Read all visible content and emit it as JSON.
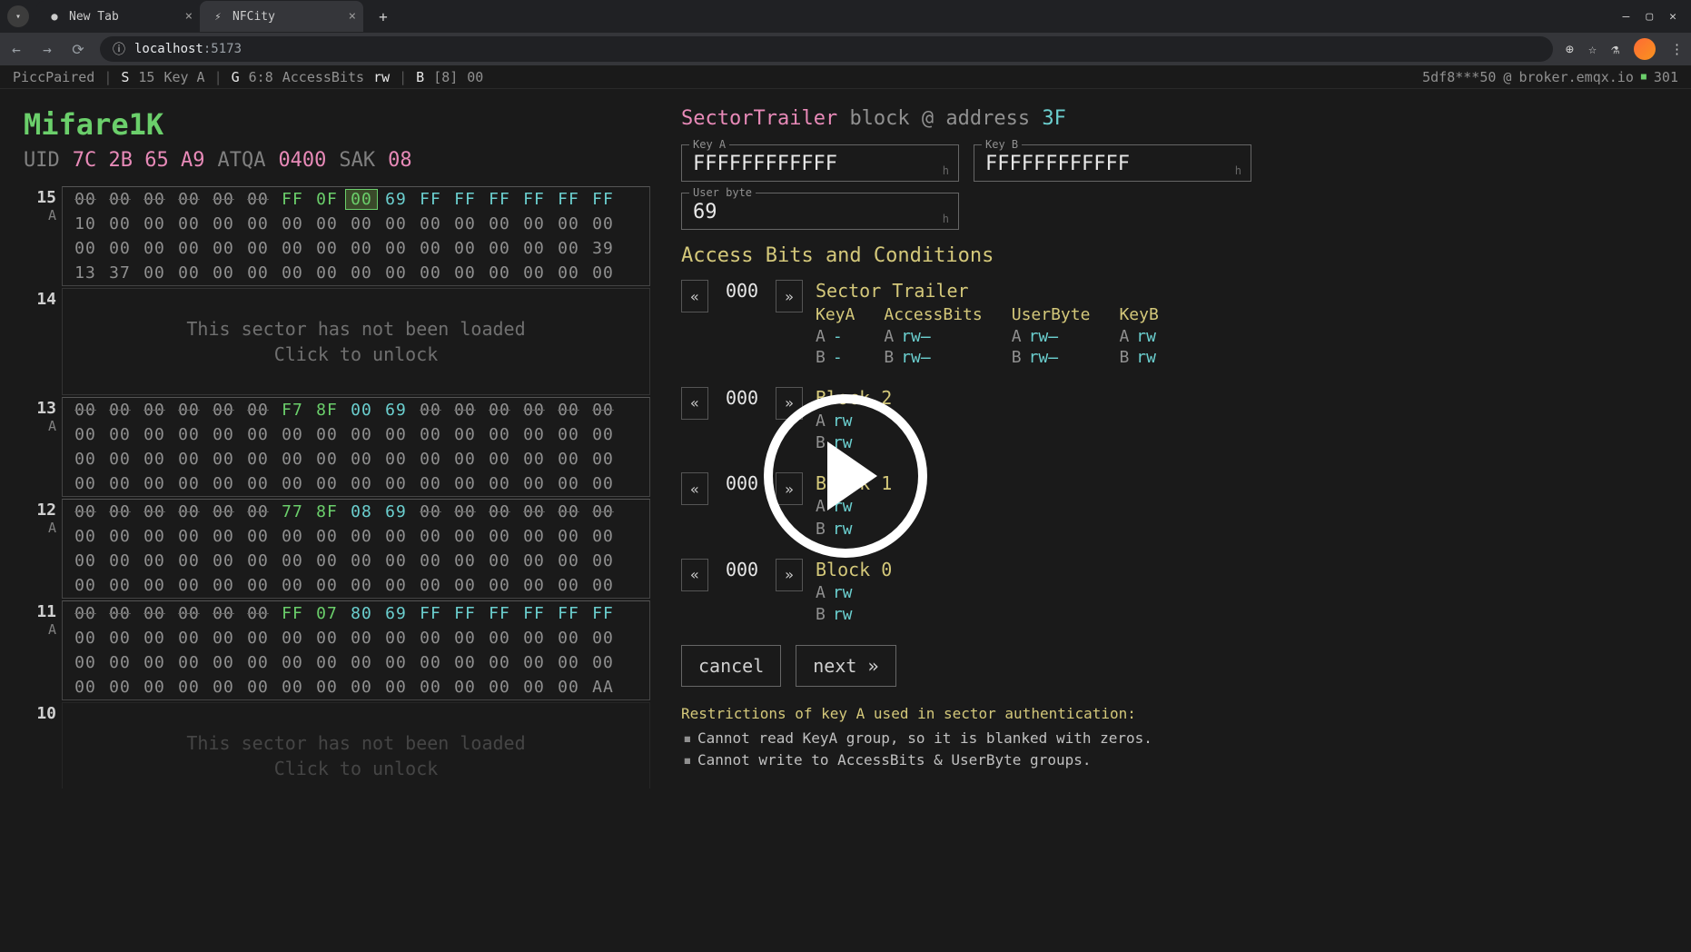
{
  "browser": {
    "tabs": [
      {
        "title": "New Tab",
        "active": false,
        "icon": "●"
      },
      {
        "title": "NFCity",
        "active": true,
        "icon": "⚡"
      }
    ],
    "url_host": "localhost",
    "url_port": ":5173",
    "win_min": "—",
    "win_max": "▢",
    "win_close": "✕"
  },
  "status": {
    "picc": "PiccPaired",
    "s_lbl": "S",
    "s_val": "15",
    "s_key": "Key A",
    "g_lbl": "G",
    "g_val": "6:8",
    "g_name": "AccessBits",
    "g_perm": "rw",
    "b_lbl": "B",
    "b_idx": "[8]",
    "b_val": "00",
    "conn_id": "5df8***50",
    "conn_at": "@",
    "conn_host": "broker.emqx.io",
    "conn_count": "301"
  },
  "card": {
    "title": "Mifare1K",
    "uid_lbl": "UID",
    "uid": "7C 2B 65 A9",
    "atqa_lbl": "ATQA",
    "atqa": "0400",
    "sak_lbl": "SAK",
    "sak": "08"
  },
  "sectors": [
    {
      "idx": "15",
      "key": "A",
      "loaded": true,
      "rows": [
        {
          "cells": [
            "00",
            "00",
            "00",
            "00",
            "00",
            "00",
            "FF",
            "0F",
            "00",
            "69",
            "FF",
            "FF",
            "FF",
            "FF",
            "FF",
            "FF"
          ],
          "style": [
            "s",
            "s",
            "s",
            "s",
            "s",
            "s",
            "g",
            "g",
            "h",
            "c",
            "c",
            "c",
            "c",
            "c",
            "c",
            "c"
          ]
        },
        {
          "cells": [
            "10",
            "00",
            "00",
            "00",
            "00",
            "00",
            "00",
            "00",
            "00",
            "00",
            "00",
            "00",
            "00",
            "00",
            "00",
            "00"
          ],
          "style": []
        },
        {
          "cells": [
            "00",
            "00",
            "00",
            "00",
            "00",
            "00",
            "00",
            "00",
            "00",
            "00",
            "00",
            "00",
            "00",
            "00",
            "00",
            "39"
          ],
          "style": []
        },
        {
          "cells": [
            "13",
            "37",
            "00",
            "00",
            "00",
            "00",
            "00",
            "00",
            "00",
            "00",
            "00",
            "00",
            "00",
            "00",
            "00",
            "00"
          ],
          "style": []
        }
      ]
    },
    {
      "idx": "14",
      "loaded": false
    },
    {
      "idx": "13",
      "key": "A",
      "loaded": true,
      "rows": [
        {
          "cells": [
            "00",
            "00",
            "00",
            "00",
            "00",
            "00",
            "F7",
            "8F",
            "00",
            "69",
            "00",
            "00",
            "00",
            "00",
            "00",
            "00"
          ],
          "style": [
            "s",
            "s",
            "s",
            "s",
            "s",
            "s",
            "g",
            "g",
            "c",
            "c",
            "s",
            "s",
            "s",
            "s",
            "s",
            "s"
          ]
        },
        {
          "cells": [
            "00",
            "00",
            "00",
            "00",
            "00",
            "00",
            "00",
            "00",
            "00",
            "00",
            "00",
            "00",
            "00",
            "00",
            "00",
            "00"
          ],
          "style": []
        },
        {
          "cells": [
            "00",
            "00",
            "00",
            "00",
            "00",
            "00",
            "00",
            "00",
            "00",
            "00",
            "00",
            "00",
            "00",
            "00",
            "00",
            "00"
          ],
          "style": []
        },
        {
          "cells": [
            "00",
            "00",
            "00",
            "00",
            "00",
            "00",
            "00",
            "00",
            "00",
            "00",
            "00",
            "00",
            "00",
            "00",
            "00",
            "00"
          ],
          "style": []
        }
      ]
    },
    {
      "idx": "12",
      "key": "A",
      "loaded": true,
      "rows": [
        {
          "cells": [
            "00",
            "00",
            "00",
            "00",
            "00",
            "00",
            "77",
            "8F",
            "08",
            "69",
            "00",
            "00",
            "00",
            "00",
            "00",
            "00"
          ],
          "style": [
            "s",
            "s",
            "s",
            "s",
            "s",
            "s",
            "g",
            "g",
            "c",
            "c",
            "s",
            "s",
            "s",
            "s",
            "s",
            "s"
          ]
        },
        {
          "cells": [
            "00",
            "00",
            "00",
            "00",
            "00",
            "00",
            "00",
            "00",
            "00",
            "00",
            "00",
            "00",
            "00",
            "00",
            "00",
            "00"
          ],
          "style": []
        },
        {
          "cells": [
            "00",
            "00",
            "00",
            "00",
            "00",
            "00",
            "00",
            "00",
            "00",
            "00",
            "00",
            "00",
            "00",
            "00",
            "00",
            "00"
          ],
          "style": []
        },
        {
          "cells": [
            "00",
            "00",
            "00",
            "00",
            "00",
            "00",
            "00",
            "00",
            "00",
            "00",
            "00",
            "00",
            "00",
            "00",
            "00",
            "00"
          ],
          "style": []
        }
      ]
    },
    {
      "idx": "11",
      "key": "A",
      "loaded": true,
      "rows": [
        {
          "cells": [
            "00",
            "00",
            "00",
            "00",
            "00",
            "00",
            "FF",
            "07",
            "80",
            "69",
            "FF",
            "FF",
            "FF",
            "FF",
            "FF",
            "FF"
          ],
          "style": [
            "s",
            "s",
            "s",
            "s",
            "s",
            "s",
            "g",
            "g",
            "c",
            "c",
            "c",
            "c",
            "c",
            "c",
            "c",
            "c"
          ]
        },
        {
          "cells": [
            "00",
            "00",
            "00",
            "00",
            "00",
            "00",
            "00",
            "00",
            "00",
            "00",
            "00",
            "00",
            "00",
            "00",
            "00",
            "00"
          ],
          "style": []
        },
        {
          "cells": [
            "00",
            "00",
            "00",
            "00",
            "00",
            "00",
            "00",
            "00",
            "00",
            "00",
            "00",
            "00",
            "00",
            "00",
            "00",
            "00"
          ],
          "style": []
        },
        {
          "cells": [
            "00",
            "00",
            "00",
            "00",
            "00",
            "00",
            "00",
            "00",
            "00",
            "00",
            "00",
            "00",
            "00",
            "00",
            "00",
            "AA"
          ],
          "style": []
        }
      ]
    },
    {
      "idx": "10",
      "loaded": false,
      "faded": true
    }
  ],
  "unloaded_text1": "This sector has not been loaded",
  "unloaded_text2": "Click to unlock",
  "trailer": {
    "pink": "SectorTrailer",
    "rest": "block @ address",
    "addr": "3F",
    "key_a_lbl": "Key A",
    "key_a": "FFFFFFFFFFFF",
    "key_b_lbl": "Key B",
    "key_b": "FFFFFFFFFFFF",
    "user_lbl": "User byte",
    "user": "69",
    "hint": "h",
    "abc_head": "Access Bits and Conditions",
    "blocks": [
      {
        "title": "Sector Trailer",
        "bits": "000",
        "cols": [
          {
            "name": "KeyA",
            "a": "A",
            "ap": "-",
            "b": "B",
            "bp": "-"
          },
          {
            "name": "AccessBits",
            "a": "A",
            "ap": "rw̶",
            "b": "B",
            "bp": "rw̶"
          },
          {
            "name": "UserByte",
            "a": "A",
            "ap": "rw̶",
            "b": "B",
            "bp": "rw̶"
          },
          {
            "name": "KeyB",
            "a": "A",
            "ap": "rw",
            "b": "B",
            "bp": "rw"
          }
        ]
      },
      {
        "title": "Block 2",
        "bits": "000",
        "a": "A",
        "ap": "rw",
        "b": "B",
        "bp": "rw"
      },
      {
        "title": "Block 1",
        "bits": "000",
        "a": "A",
        "ap": "rw",
        "b": "B",
        "bp": "rw"
      },
      {
        "title": "Block 0",
        "bits": "000",
        "a": "A",
        "ap": "rw",
        "b": "B",
        "bp": "rw"
      }
    ],
    "cancel": "cancel",
    "next": "next »",
    "restrict_head": "Restrictions of key A used in sector authentication:",
    "restrict": [
      "Cannot read KeyA group, so it is blanked with zeros.",
      "Cannot write to AccessBits & UserByte groups."
    ]
  }
}
